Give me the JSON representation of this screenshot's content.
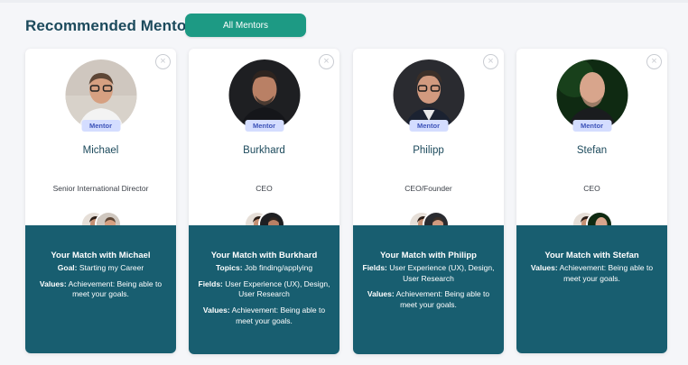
{
  "page": {
    "title": "Recommended Mentors",
    "all_mentors_label": "All Mentors"
  },
  "colors": {
    "accent_teal": "#1d9a84",
    "match_panel": "#185e70",
    "title_color": "#1c4a5c",
    "badge_bg": "#d4ddff",
    "badge_text": "#3d53b8"
  },
  "cards": [
    {
      "name": "Michael",
      "badge": "Mentor",
      "role": "Senior International Director",
      "match_title": "Your Match with Michael",
      "rows": [
        {
          "label": "Goal:",
          "text": "Starting my Career"
        },
        {
          "label": "Values:",
          "text": "Achievement: Being able to meet your goals."
        }
      ],
      "close_icon": "close-icon"
    },
    {
      "name": "Burkhard",
      "badge": "Mentor",
      "role": "CEO",
      "match_title": "Your Match with Burkhard",
      "rows": [
        {
          "label": "Topics:",
          "text": "Job finding/applying"
        },
        {
          "label": "Fields:",
          "text": "User Experience (UX), Design, User Research"
        },
        {
          "label": "Values:",
          "text": "Achievement: Being able to meet your goals."
        }
      ],
      "close_icon": "close-icon"
    },
    {
      "name": "Philipp",
      "badge": "Mentor",
      "role": "CEO/Founder",
      "match_title": "Your Match with Philipp",
      "rows": [
        {
          "label": "Fields:",
          "text": "User Experience (UX), Design, User Research"
        },
        {
          "label": "Values:",
          "text": "Achievement: Being able to meet your goals."
        }
      ],
      "close_icon": "close-icon"
    },
    {
      "name": "Stefan",
      "badge": "Mentor",
      "role": "CEO",
      "match_title": "Your Match with Stefan",
      "rows": [
        {
          "label": "Values:",
          "text": "Achievement: Being able to meet your goals."
        }
      ],
      "close_icon": "close-icon"
    }
  ]
}
